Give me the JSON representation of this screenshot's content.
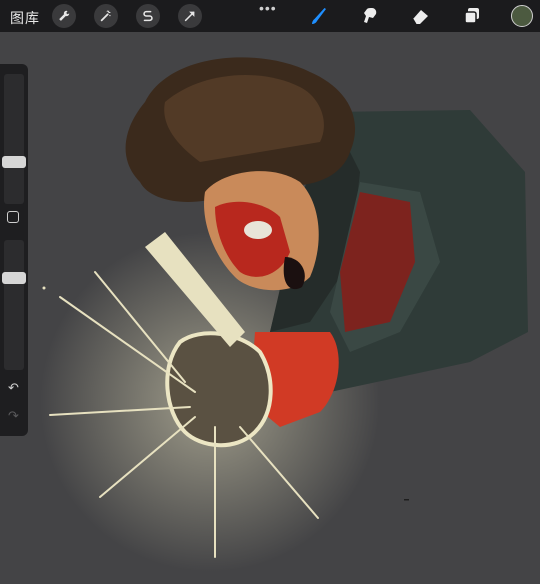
{
  "toolbar": {
    "gallery_label": "图库",
    "left_tools": [
      "wrench-icon",
      "magic-wand-icon",
      "selection-icon",
      "transform-arrow-icon"
    ],
    "more_label": "•••",
    "right_tools": [
      "brush-icon",
      "smudge-icon",
      "eraser-icon",
      "layers-icon"
    ],
    "active_tool": "brush-icon",
    "accent_color": "#1f8fff",
    "current_color": "#4c5a40"
  },
  "sidebar": {
    "brush_size_level": 0.38,
    "opacity_level": 0.32,
    "undo_label": "↶",
    "redo_label": "↷"
  },
  "canvas": {
    "background": "#444446"
  }
}
